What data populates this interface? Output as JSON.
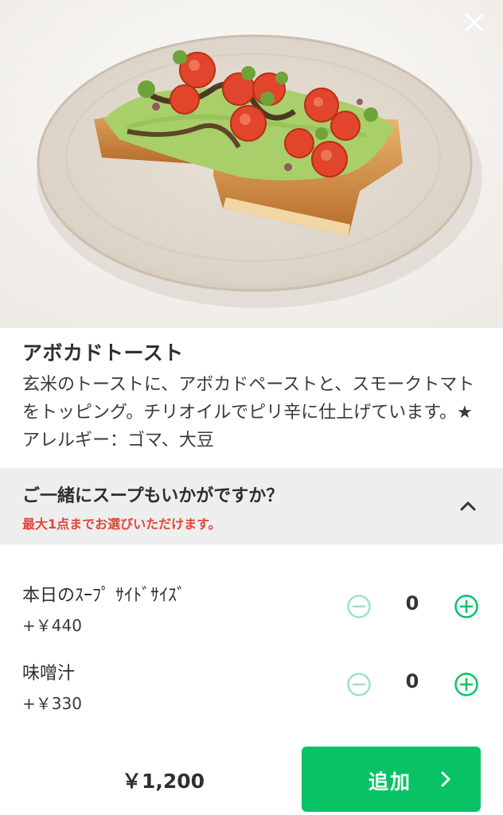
{
  "item": {
    "title": "アボカドトースト",
    "description": "玄米のトーストに、アボカドペーストと、スモークトマトをトッピング。チリオイルでピリ辛に仕上げています。★アレルギー：ゴマ、大豆"
  },
  "soup_section": {
    "title": "ご一緒にスープもいかがですか？",
    "note": "最大1点までお選びいただけます。",
    "options": [
      {
        "name": "本日のｽｰﾌﾟ ｻｲﾄﾞｻｲｽﾞ",
        "price": "+￥440",
        "quantity": "0"
      },
      {
        "name": "味噌汁",
        "price": "+￥330",
        "quantity": "0"
      }
    ]
  },
  "footer": {
    "total": "￥1,200",
    "add_label": "追加"
  },
  "icons": {
    "close": "close-icon",
    "collapse": "chevron-up-icon",
    "minus": "minus-circle-icon",
    "plus": "plus-circle-icon",
    "add_arrow": "chevron-right-icon"
  },
  "colors": {
    "accent_green": "#07c366",
    "minus_disabled": "#9fe2bf",
    "plus_active": "#07c366",
    "note_red": "#e0463c",
    "section_bg": "#eeeeee"
  }
}
